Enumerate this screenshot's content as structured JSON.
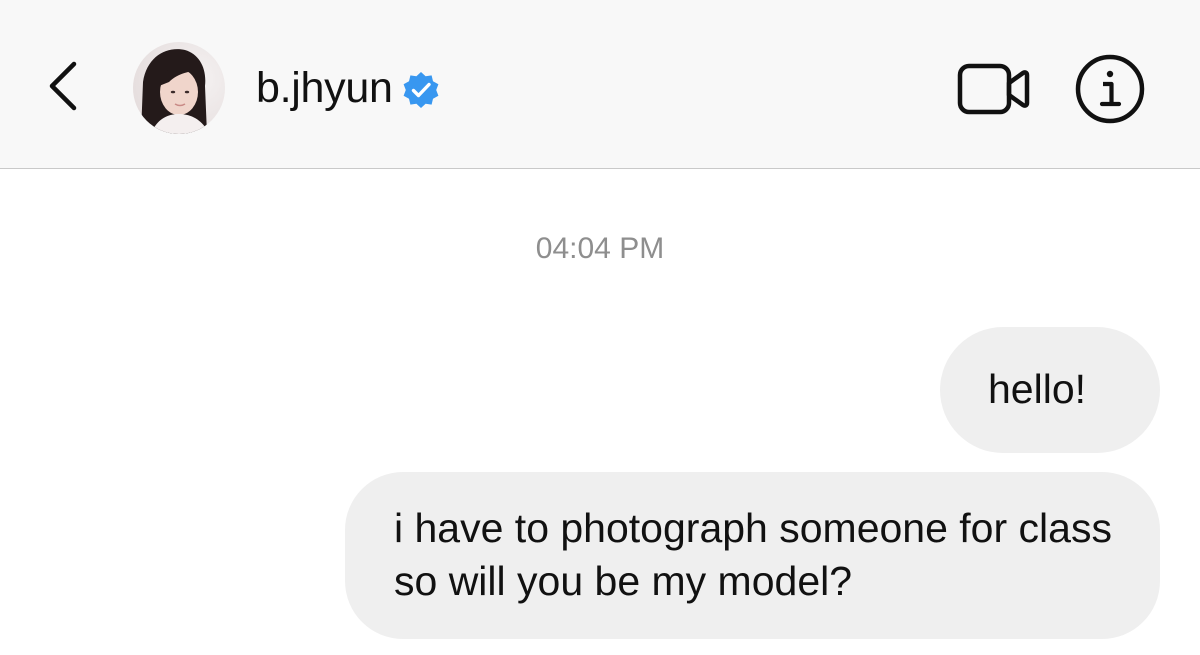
{
  "header": {
    "username": "b.jhyun",
    "verified": true,
    "back_icon": "chevron-left-icon",
    "video_icon": "video-camera-icon",
    "info_icon": "info-circle-icon",
    "badge_color": "#3897f0"
  },
  "conversation": {
    "timestamp": "04:04 PM",
    "messages": [
      {
        "sender": "me",
        "text": "hello!"
      },
      {
        "sender": "me",
        "text": "i have to photograph someone for class so will you be my model?"
      }
    ]
  },
  "colors": {
    "header_background": "#f8f8f8",
    "bubble_background": "#efefef",
    "timestamp_text": "#8e8e8e"
  }
}
